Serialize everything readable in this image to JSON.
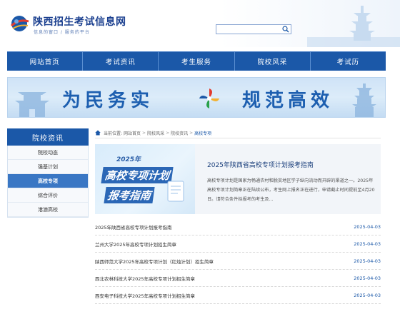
{
  "header": {
    "site_title": "陕西招生考试信息网",
    "slogan": "信息的窗口 / 服务的平台",
    "search_placeholder": ""
  },
  "nav": {
    "items": [
      "网站首页",
      "考试资讯",
      "考生服务",
      "院校风采",
      "考试历"
    ]
  },
  "banner": {
    "left_text": "为民务实",
    "right_text": "规范高效"
  },
  "sidebar": {
    "title": "院校资讯",
    "items": [
      {
        "label": "院校动态",
        "active": false
      },
      {
        "label": "强基计划",
        "active": false
      },
      {
        "label": "高校专项",
        "active": true
      },
      {
        "label": "综合评价",
        "active": false
      },
      {
        "label": "港澳高校",
        "active": false
      }
    ]
  },
  "breadcrumb": {
    "items": [
      "当前位置:",
      "网站首页",
      "院校风采",
      "院校资讯",
      "高校专项"
    ]
  },
  "feature": {
    "image_year": "2025年",
    "image_line1": "高校专项计划",
    "image_line2": "报考指南",
    "title": "2025年陕西省高校专项计划报考指南",
    "summary": "高校专项计划是国家为畅通农村和脱贫地区学子纵向流动而开辟的渠道之一。2025年高校专项计划简章正在陆续公布，考生网上报名正在进行，申请截止时间提前至4月20日。请符合条件拟报考的考生及..."
  },
  "news": [
    {
      "title": "2025年陕西省高校专项计划报考指南",
      "date": "2025-04-03"
    },
    {
      "title": "兰州大学2025年高校专项计划招生简章",
      "date": "2025-04-03"
    },
    {
      "title": "陕西师范大学2025年高校专项计划（红烛计划）招生简章",
      "date": "2025-04-03"
    },
    {
      "title": "西北农林科技大学2025年高校专项计划招生简章",
      "date": "2025-04-03"
    },
    {
      "title": "西安电子科技大学2025年高校专项计划招生简章",
      "date": "2025-04-03"
    }
  ],
  "colors": {
    "primary": "#1b58a8",
    "sidebar_active": "#3a77c4"
  },
  "icons": {
    "logo": "globe-swoosh-logo",
    "search": "search-icon",
    "home": "home-icon"
  }
}
